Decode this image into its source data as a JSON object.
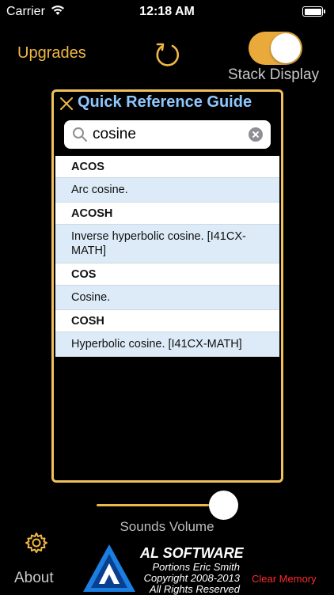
{
  "status_bar": {
    "carrier": "Carrier",
    "time": "12:18 AM"
  },
  "header": {
    "upgrades_label": "Upgrades",
    "stack_display_label": "Stack Display",
    "stack_display_on": true
  },
  "panel": {
    "title": "Quick Reference Guide",
    "search": {
      "value": "cosine",
      "placeholder": ""
    },
    "results": [
      {
        "name": "ACOS",
        "description": "Arc cosine."
      },
      {
        "name": "ACOSH",
        "description": "Inverse hyperbolic cosine. [I41CX-MATH]"
      },
      {
        "name": "COS",
        "description": "Cosine."
      },
      {
        "name": "COSH",
        "description": "Hyperbolic cosine. [I41CX-MATH]"
      }
    ]
  },
  "sounds": {
    "label": "Sounds Volume",
    "volume_fraction": 0.9
  },
  "footer": {
    "about_label": "About",
    "clear_memory_label": "Clear Memory",
    "logo": {
      "title": "AL SOFTWARE",
      "line1": "Portions Eric Smith",
      "line2": "Copyright 2008-2013",
      "line3": "All Rights Reserved"
    }
  },
  "colors": {
    "accent": "#f0b845",
    "title_blue": "#8fc7ff",
    "danger": "#ff2a2a",
    "row_alt": "#dcebf7"
  }
}
